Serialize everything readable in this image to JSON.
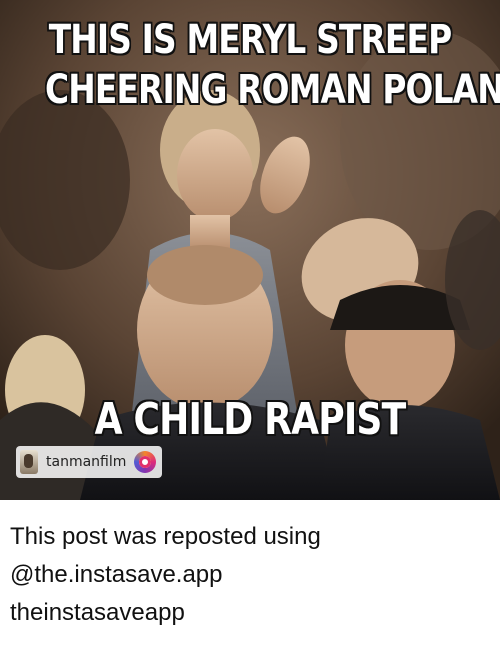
{
  "meme": {
    "top_line_1": "THIS IS MERYL STREEP",
    "top_line_2": "CHEERING ROMAN POLANSKI",
    "bottom_line": "A CHILD RAPIST"
  },
  "watermark": {
    "username": "tanmanfilm",
    "avatar_icon": "user-avatar-icon",
    "logo_icon": "instagram-logo-icon"
  },
  "caption": {
    "line_1": "This post was reposted using",
    "line_2": "@the.instasave.app",
    "line_3": "theinstasaveapp"
  }
}
